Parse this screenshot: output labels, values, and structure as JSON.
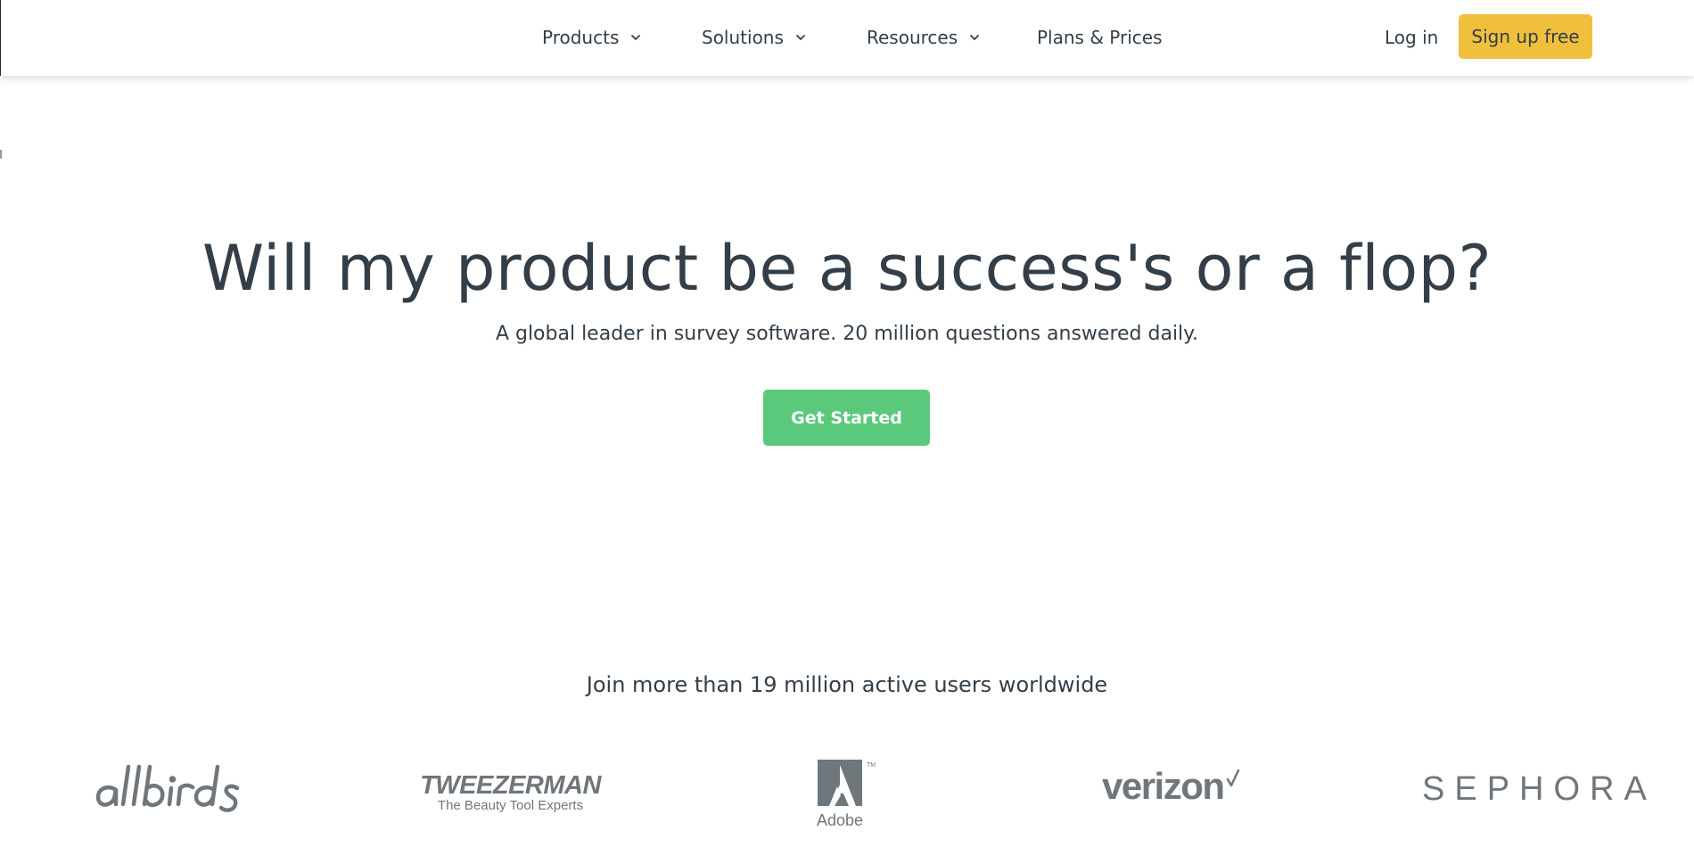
{
  "nav": {
    "items": [
      {
        "label": "Products",
        "has_dropdown": true,
        "icon": "chevron-down-icon"
      },
      {
        "label": "Solutions",
        "has_dropdown": true,
        "icon": "chevron-down-icon"
      },
      {
        "label": "Resources",
        "has_dropdown": true,
        "icon": "chevron-down-icon"
      },
      {
        "label": "Plans & Prices",
        "has_dropdown": false
      }
    ],
    "login_label": "Log in",
    "signup_label": "Sign up free"
  },
  "hero": {
    "title": "Will my product be a success's or a flop?",
    "subtitle": "A global leader in survey software. 20 million questions answered daily.",
    "cta_label": "Get Started"
  },
  "social_proof": {
    "heading": "Join more than 19 million active users worldwide",
    "logos": [
      {
        "name": "allbirds",
        "text": "allbirds"
      },
      {
        "name": "tweezerman",
        "text": "TWEEZERMAN",
        "tagline": "The Beauty Tool Experts"
      },
      {
        "name": "adobe",
        "text": "Adobe"
      },
      {
        "name": "verizon",
        "text": "verizon"
      },
      {
        "name": "sephora",
        "text": "SEPHORA"
      }
    ]
  },
  "colors": {
    "text": "#333e48",
    "signup_bg": "#f0bf3c",
    "cta_bg": "#5bc97b",
    "logo_gray": "#6f767c"
  }
}
